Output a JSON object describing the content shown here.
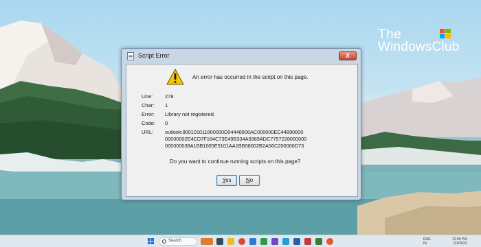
{
  "watermark": {
    "line1": "The",
    "line2": "WindowsClub"
  },
  "dialog": {
    "title": "Script Error",
    "close_label": "X",
    "message": "An error has occurred in the script on this page.",
    "fields": {
      "line_label": "Line:",
      "line_value": "278",
      "char_label": "Char:",
      "char_value": "1",
      "error_label": "Error:",
      "error_value": "Library not registered.",
      "code_label": "Code:",
      "code_value": "0",
      "url_label": "URL:",
      "url_lines": [
        "outlook:800101011800000D04448906AC000000EC44890600",
        "00000002E4CD7F184C73E49B334A9369ADC7757228000000",
        "000000038A1BB1005E5101AA1BB08002B2A56C200006D73"
      ]
    },
    "question": "Do you want to continue running scripts on this page?",
    "yes": {
      "pre": "",
      "accel": "Y",
      "post": "es"
    },
    "no": {
      "pre": "",
      "accel": "N",
      "post": "o"
    }
  },
  "taskbar": {
    "search_placeholder": "Search",
    "tray_lang": "ENG",
    "tray_region": "IN",
    "time": "12:09 PM",
    "date": "2/1/2023"
  },
  "colors": {
    "accent": "#1a73d9",
    "dialog_frame": "#c9d7e4",
    "close_button": "#c9432b"
  }
}
